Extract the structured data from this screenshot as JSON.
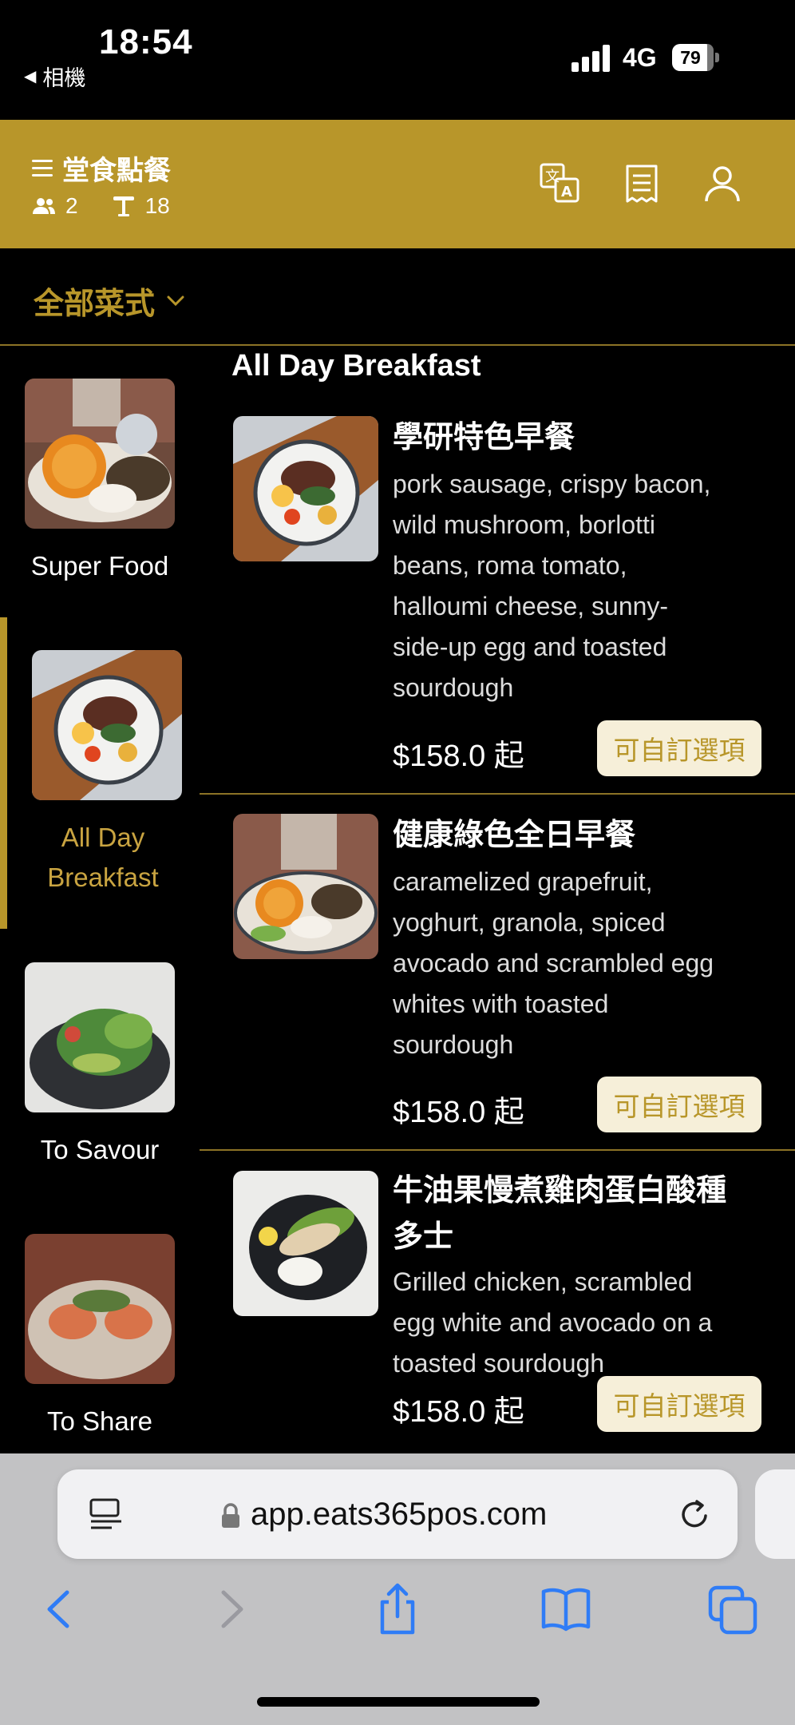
{
  "status_bar": {
    "time": "18:54",
    "back_app": "相機",
    "network": "4G",
    "battery": "79"
  },
  "header": {
    "title": "堂食點餐",
    "guests": "2",
    "table": "18",
    "icons": [
      "menu-icon",
      "people-icon",
      "table-icon",
      "translate-icon",
      "receipt-icon",
      "user-icon"
    ]
  },
  "category_selector": {
    "label": "全部菜式"
  },
  "sidebar": {
    "items": [
      {
        "label": "Super Food",
        "active": false
      },
      {
        "label": "All Day Breakfast",
        "active": true
      },
      {
        "label": "To Savour",
        "active": false
      },
      {
        "label": "To Share",
        "active": false
      }
    ]
  },
  "section": {
    "title": "All Day Breakfast"
  },
  "menu_items": [
    {
      "name": "學研特色早餐",
      "desc_lines": [
        "pork sausage, crispy bacon,",
        "wild mushroom, borlotti",
        "beans, roma tomato,",
        "halloumi cheese, sunny-",
        "side-up egg and toasted",
        "sourdough"
      ],
      "price": "$158.0 起",
      "button": "可自訂選項"
    },
    {
      "name": "健康綠色全日早餐",
      "desc_lines": [
        "caramelized grapefruit,",
        "yoghurt, granola, spiced",
        "avocado and scrambled egg",
        "whites with toasted",
        "sourdough"
      ],
      "price": "$158.0 起",
      "button": "可自訂選項"
    },
    {
      "name_lines": [
        "牛油果慢煮雞肉蛋白酸種",
        "多士"
      ],
      "desc_lines": [
        "Grilled chicken, scrambled",
        "egg white and avocado on a",
        "toasted sourdough"
      ],
      "price": "$158.0 起",
      "button": "可自訂選項"
    }
  ],
  "browser": {
    "url": "app.eats365pos.com"
  },
  "colors": {
    "accent": "#b8962a",
    "background": "#000000",
    "button_bg": "#f6efd9",
    "browser_bar": "#c2c2c4",
    "ios_blue": "#2f7cf6"
  }
}
